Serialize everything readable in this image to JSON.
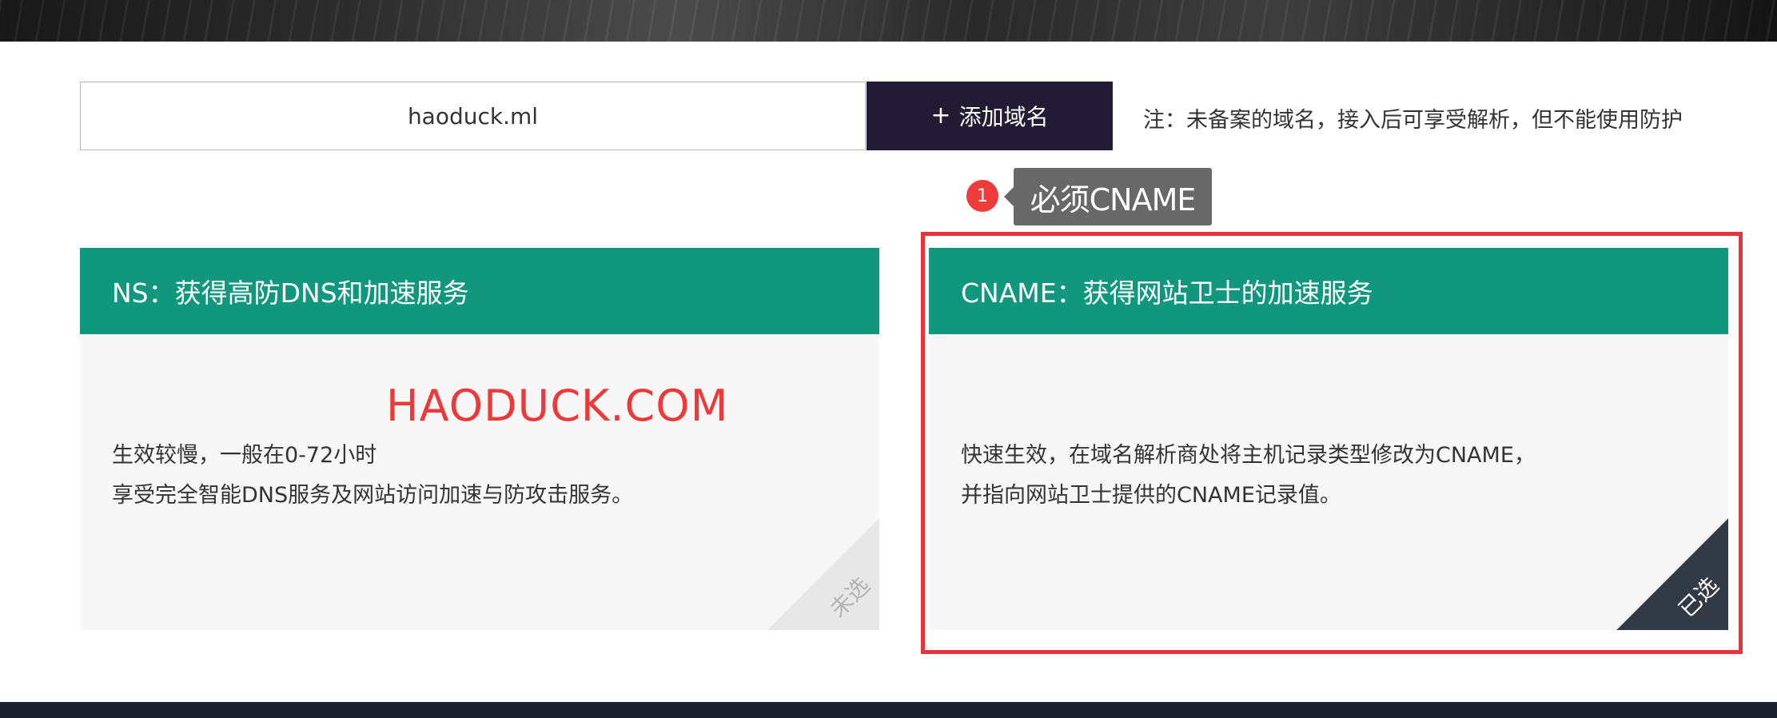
{
  "domain_input": {
    "value": "haoduck.ml"
  },
  "add_button": {
    "icon": "plus-icon",
    "plus": "+",
    "label": "添加域名",
    "bg_color": "#211c33"
  },
  "note": "注：未备案的域名，接入后可享受解析，但不能使用防护",
  "annotation": {
    "step_number": "1",
    "tooltip": "必须CNAME",
    "highlight_color": "#e8323c"
  },
  "watermark": "HAODUCK.COM",
  "cards": {
    "ns": {
      "title": "NS：获得高防DNS和加速服务",
      "desc_line1": "生效较慢，一般在0-72小时",
      "desc_line2": "享受完全智能DNS服务及网站访问加速与防攻击服务。",
      "status": "未选",
      "selected": false
    },
    "cname": {
      "title": "CNAME：获得网站卫士的加速服务",
      "desc_line1": "快速生效，在域名解析商处将主机记录类型修改为CNAME，",
      "desc_line2": "并指向网站卫士提供的CNAME记录值。",
      "status": "已选",
      "selected": true
    }
  },
  "colors": {
    "card_header": "#12977f",
    "selected_corner": "#323a46",
    "unselected_corner": "#e7e7e7"
  }
}
